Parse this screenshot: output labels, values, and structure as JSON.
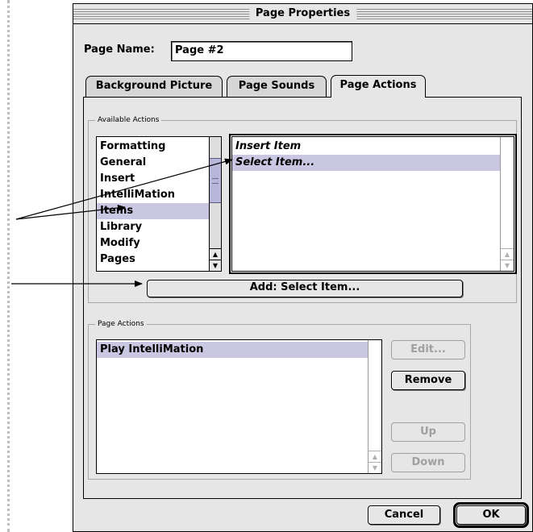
{
  "dialog": {
    "title": "Page Properties",
    "page_name_label": "Page Name:",
    "page_name_value": "Page #2"
  },
  "tabs": [
    {
      "label": "Background Picture",
      "active": false
    },
    {
      "label": "Page Sounds",
      "active": false
    },
    {
      "label": "Page Actions",
      "active": true
    }
  ],
  "available_actions": {
    "group_label": "Available Actions",
    "categories": [
      "Formatting",
      "General",
      "Insert",
      "IntelliMation",
      "Items",
      "Library",
      "Modify",
      "Pages"
    ],
    "selected_category": "Items",
    "actions": [
      "Insert Item",
      "Select Item..."
    ],
    "selected_action": "Select Item...",
    "add_button_label": "Add:  Select Item..."
  },
  "page_actions": {
    "group_label": "Page Actions",
    "items": [
      "Play IntelliMation"
    ],
    "selected_item": "Play IntelliMation",
    "edit_label": "Edit...",
    "remove_label": "Remove",
    "up_label": "Up",
    "down_label": "Down"
  },
  "footer": {
    "cancel_label": "Cancel",
    "ok_label": "OK"
  },
  "icons": {
    "scroll_up": "up-arrow-icon",
    "scroll_down": "down-arrow-icon"
  },
  "colors": {
    "selection": "#cac7e3",
    "scroll_thumb": "#b8b6d9",
    "window_bg": "#e6e6e6"
  }
}
